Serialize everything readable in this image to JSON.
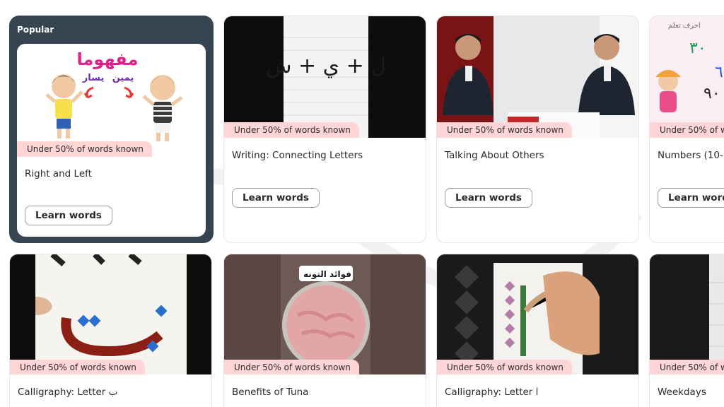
{
  "section": {
    "label": "Popular"
  },
  "badge_text": "Under 50% of words known",
  "learn_label": "Learn words",
  "cards": [
    {
      "title": "Right and Left",
      "thumb_text": {
        "top": "مفهوما",
        "right": "يمين",
        "left": "يسار"
      }
    },
    {
      "title": "Writing: Connecting Letters",
      "thumb_text": {
        "main": "ل + ي + ش"
      }
    },
    {
      "title": "Talking About Others"
    },
    {
      "title": "Numbers (10-1",
      "thumb_text": {
        "top": "احرف تعلم",
        "n1": "٣٠",
        "n2": "٦",
        "n3": "٩٠"
      }
    },
    {
      "title": "Calligraphy: Letter ب"
    },
    {
      "title": "Benefits of Tuna",
      "thumb_text": {
        "caption": "فوائد التونه"
      }
    },
    {
      "title": "Calligraphy: Letter ا"
    },
    {
      "title": "Weekdays"
    }
  ],
  "colors": {
    "popular_bg": "#364452",
    "badge_bg": "#ffd5d6",
    "button_border": "#9a9a9f"
  }
}
